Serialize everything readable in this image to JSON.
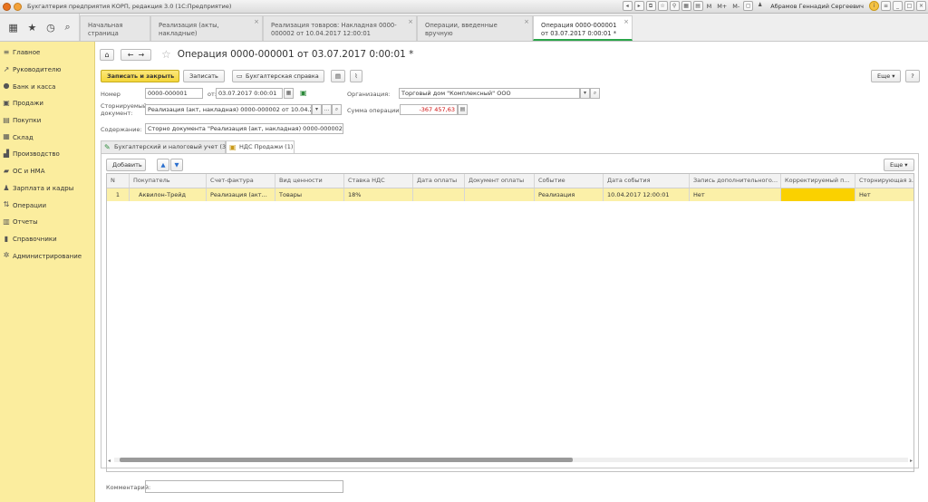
{
  "window": {
    "title": "Бухгалтерия предприятия КОРП, редакция 3.0  (1С:Предприятие)",
    "user": "Абрамов Геннадий Сергеевич",
    "memory_buttons": [
      "M",
      "M+",
      "M-"
    ]
  },
  "tabs": [
    {
      "label": "Начальная страница"
    },
    {
      "label": "Реализация (акты, накладные)"
    },
    {
      "label": "Реализация товаров: Накладная 0000-000002 от 10.04.2017 12:00:01"
    },
    {
      "label": "Операции, введенные вручную"
    },
    {
      "label": "Операция 0000-000001 от 03.07.2017 0:00:01 *"
    }
  ],
  "sidebar": {
    "items": [
      {
        "label": "Главное",
        "icon": "menu-icon"
      },
      {
        "label": "Руководителю",
        "icon": "chart-icon"
      },
      {
        "label": "Банк и касса",
        "icon": "bank-icon"
      },
      {
        "label": "Продажи",
        "icon": "sales-icon"
      },
      {
        "label": "Покупки",
        "icon": "cart-icon"
      },
      {
        "label": "Склад",
        "icon": "warehouse-icon"
      },
      {
        "label": "Производство",
        "icon": "factory-icon"
      },
      {
        "label": "ОС и НМА",
        "icon": "truck-icon"
      },
      {
        "label": "Зарплата и кадры",
        "icon": "people-icon"
      },
      {
        "label": "Операции",
        "icon": "operations-icon"
      },
      {
        "label": "Отчеты",
        "icon": "reports-icon"
      },
      {
        "label": "Справочники",
        "icon": "book-icon"
      },
      {
        "label": "Администрирование",
        "icon": "gear-icon"
      }
    ]
  },
  "document": {
    "title": "Операция 0000-000001 от 03.07.2017 0:00:01 *",
    "buttons": {
      "save_close": "Записать и закрыть",
      "save": "Записать",
      "report": "Бухгалтерская справка",
      "more": "Еще",
      "help": "?"
    },
    "fields": {
      "number_label": "Номер",
      "number_value": "0000-000001",
      "date_label": "от:",
      "date_value": "03.07.2017  0:00:01",
      "org_label": "Организация:",
      "org_value": "Торговый дом \"Комплексный\" ООО",
      "storno_label_1": "Сторнируемый",
      "storno_label_2": "документ:",
      "storno_value": "Реализация (акт, накладная) 0000-000002 от 10.04.2017 1",
      "sum_label": "Сумма операции:",
      "sum_value": "-367 457,63",
      "content_label": "Содержание:",
      "content_value": "Сторно документа \"Реализация (акт, накладная) 0000-000002 от 10"
    },
    "subtabs": [
      {
        "label": "Бухгалтерский и налоговый учет (3)"
      },
      {
        "label": "НДС Продажи (1)"
      }
    ],
    "table_toolbar": {
      "add": "Добавить",
      "more": "Еще"
    },
    "columns": [
      "N",
      "Покупатель",
      "Счет-фактура",
      "Вид ценности",
      "Ставка НДС",
      "Дата оплаты",
      "Документ оплаты",
      "Событие",
      "Дата события",
      "Запись дополнительного...",
      "Корректируемый п...",
      "Сторнирующая з..."
    ],
    "rows": [
      [
        "1",
        "Аквилон-Трейд",
        "Реализация (акт...",
        "Товары",
        "18%",
        "",
        "",
        "Реализация",
        "10.04.2017 12:00:01",
        "Нет",
        "",
        "Нет"
      ]
    ],
    "comment_label": "Комментарий:"
  },
  "colors": {
    "sidebar_bg": "#fbed9e",
    "primary_button": "#f4d63a",
    "selected_row": "#fbf0a8",
    "highlight_cell": "#fad100",
    "negative_amount": "#d01010"
  }
}
